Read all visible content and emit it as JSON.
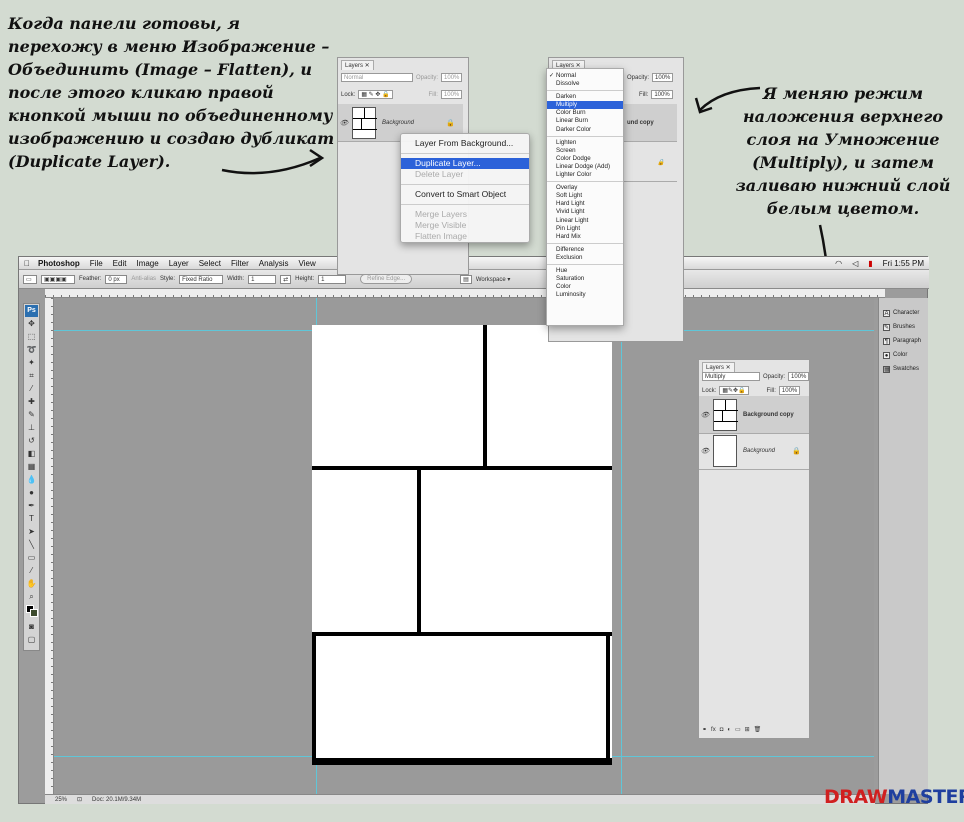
{
  "annotations": {
    "left": "Когда панели готовы, я\nперехожу в меню Изображение –\nОбъединить (Image – Flatten), и\nпосле этого кликаю правой\nкнопкой мыши по объединенному\nизображению и создаю дубликат\n(Duplicate Layer).",
    "right": "Я меняю режим\nналожения верхнего\nслоя на Умножение\n(Multiply), и затем\nзаливаю нижний слой\nбелым цветом."
  },
  "menubar": {
    "app": "Photoshop",
    "items": [
      "File",
      "Edit",
      "Image",
      "Layer",
      "Select",
      "Filter",
      "Analysis",
      "View"
    ],
    "clock": "Fri 1:55 PM"
  },
  "options_bar": {
    "feather_label": "Feather:",
    "feather_value": "0 px",
    "anti_alias": "Anti-alias",
    "style_label": "Style:",
    "style_value": "Fixed Ratio",
    "width_label": "Width:",
    "width_value": "1",
    "height_label": "Height:",
    "height_value": "1",
    "refine_edge": "Refine Edge...",
    "workspace": "Workspace ▾"
  },
  "status_bar": {
    "zoom": "25%",
    "doc_info": "Doc: 20.1M/9.34M"
  },
  "dock": {
    "items": [
      {
        "label": "Character",
        "icon": "character-icon"
      },
      {
        "label": "Brushes",
        "icon": "brushes-icon"
      },
      {
        "label": "Paragraph",
        "icon": "paragraph-icon"
      },
      {
        "label": "Color",
        "icon": "color-icon"
      },
      {
        "label": "Swatches",
        "icon": "swatches-icon"
      }
    ]
  },
  "layers_panel_1": {
    "tab": "Layers",
    "blend_mode": "Normal",
    "opacity_label": "Opacity:",
    "opacity_value": "100%",
    "lock_label": "Lock:",
    "fill_label": "Fill:",
    "fill_value": "100%",
    "layer_name": "Background"
  },
  "context_menu": {
    "items": [
      {
        "label": "Layer From Background...",
        "state": "normal"
      },
      {
        "label": "Duplicate Layer...",
        "state": "selected"
      },
      {
        "label": "Delete Layer",
        "state": "disabled"
      },
      {
        "label": "Convert to Smart Object",
        "state": "normal"
      },
      {
        "label": "Merge Layers",
        "state": "disabled"
      },
      {
        "label": "Merge Visible",
        "state": "disabled"
      },
      {
        "label": "Flatten Image",
        "state": "disabled"
      }
    ]
  },
  "layers_panel_2": {
    "tab": "Layers",
    "opacity_label": "Opacity:",
    "opacity_value": "100%",
    "fill_label": "Fill:",
    "fill_value": "100%",
    "layer_partial_name": "und copy"
  },
  "blend_menu": {
    "groups": [
      [
        "Normal",
        "Dissolve"
      ],
      [
        "Darken",
        "Multiply",
        "Color Burn",
        "Linear Burn",
        "Darker Color"
      ],
      [
        "Lighten",
        "Screen",
        "Color Dodge",
        "Linear Dodge (Add)",
        "Lighter Color"
      ],
      [
        "Overlay",
        "Soft Light",
        "Hard Light",
        "Vivid Light",
        "Linear Light",
        "Pin Light",
        "Hard Mix"
      ],
      [
        "Difference",
        "Exclusion"
      ],
      [
        "Hue",
        "Saturation",
        "Color",
        "Luminosity"
      ]
    ],
    "checked": "Normal",
    "highlighted": "Multiply"
  },
  "layers_panel_3": {
    "tab": "Layers",
    "blend_mode": "Multiply",
    "opacity_label": "Opacity:",
    "opacity_value": "100%",
    "lock_label": "Lock:",
    "fill_label": "Fill:",
    "fill_value": "100%",
    "layers": [
      "Background copy",
      "Background"
    ]
  },
  "logo": {
    "part1": "DRAW",
    "part2": "MASTER.RU"
  },
  "colors": {
    "page_bg": "#d3dbd1",
    "highlight": "#2c62d9",
    "guide": "#5fc6d8",
    "logo_red": "#d02020",
    "logo_blue": "#1f3f9f"
  }
}
